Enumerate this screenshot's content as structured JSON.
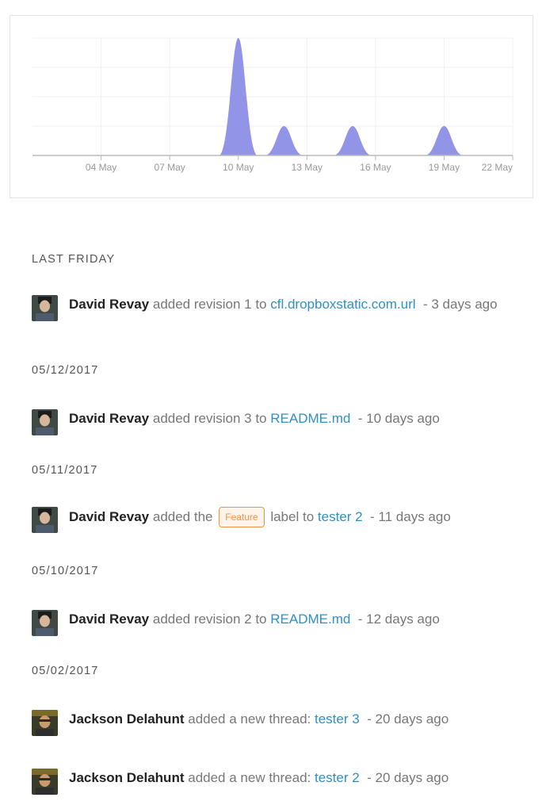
{
  "chart_data": {
    "type": "area",
    "x_ticks": [
      "04 May",
      "07 May",
      "10 May",
      "13 May",
      "16 May",
      "19 May",
      "22 May"
    ],
    "x": [
      "01 May",
      "02 May",
      "03 May",
      "04 May",
      "05 May",
      "06 May",
      "07 May",
      "08 May",
      "09 May",
      "10 May",
      "11 May",
      "12 May",
      "13 May",
      "14 May",
      "15 May",
      "16 May",
      "17 May",
      "18 May",
      "19 May",
      "20 May",
      "21 May",
      "22 May"
    ],
    "values": [
      0,
      0,
      0,
      0,
      0,
      0,
      0,
      0,
      0,
      4,
      0,
      1,
      0,
      0,
      1,
      0,
      0,
      0,
      1,
      0,
      0,
      0
    ],
    "ylim": [
      0,
      4
    ],
    "grid": true,
    "color": "#8b8ee6"
  },
  "feed": [
    {
      "date": "LAST FRIDAY",
      "events": [
        {
          "user": "David Revay",
          "action": "added revision 1 to",
          "target": "cfl.dropboxstatic.com.url",
          "time": "- 3 days ago",
          "avatar": "avatar-david"
        }
      ]
    },
    {
      "date": "05/12/2017",
      "events": [
        {
          "user": "David Revay",
          "action": "added revision 3 to",
          "target": "README.md",
          "time": "- 10 days ago",
          "avatar": "avatar-david"
        }
      ]
    },
    {
      "date": "05/11/2017",
      "events": [
        {
          "user": "David Revay",
          "action": "added the",
          "label": "Feature",
          "action2": "label to",
          "target": "tester 2",
          "time": "- 11 days ago",
          "avatar": "avatar-david"
        }
      ]
    },
    {
      "date": "05/10/2017",
      "events": [
        {
          "user": "David Revay",
          "action": "added revision 2 to",
          "target": "README.md",
          "time": "- 12 days ago",
          "avatar": "avatar-david"
        }
      ]
    },
    {
      "date": "05/02/2017",
      "events": [
        {
          "user": "Jackson Delahunt",
          "action": "added a new thread:",
          "target": "tester 3",
          "time": "- 20 days ago",
          "avatar": "avatar-jackson"
        },
        {
          "user": "Jackson Delahunt",
          "action": "added a new thread:",
          "target": "tester 2",
          "time": "- 20 days ago",
          "avatar": "avatar-jackson"
        }
      ]
    }
  ],
  "colors": {
    "link": "#2f8fc6",
    "badge": "#f0934a",
    "area": "#8b8ee6"
  }
}
